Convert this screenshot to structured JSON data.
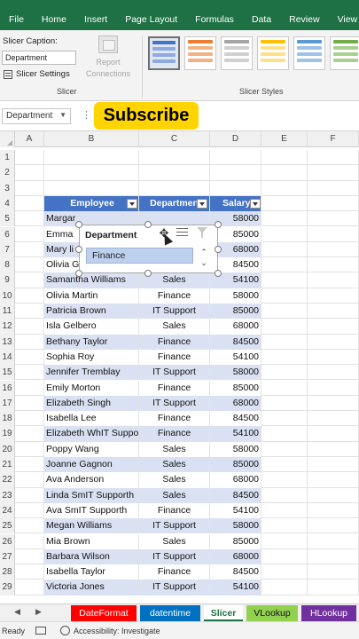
{
  "ribbon": {
    "tabs": [
      "File",
      "Home",
      "Insert",
      "Page Layout",
      "Formulas",
      "Data",
      "Review",
      "View"
    ],
    "slicer_caption_label": "Slicer Caption:",
    "slicer_caption_value": "Department",
    "slicer_settings_label": "Slicer Settings",
    "report_connections_label": "Report Connections",
    "slicer_group_label": "Slicer",
    "slicer_styles_group_label": "Slicer Styles",
    "style_colors": [
      "#4472c4",
      "#ed7d31",
      "#a5a5a5",
      "#ffc000",
      "#5b9bd5",
      "#70ad47"
    ]
  },
  "formula_bar": {
    "name_box": "Department",
    "overlay_text": "Subscribe"
  },
  "columns": [
    "A",
    "B",
    "C",
    "D",
    "E",
    "F"
  ],
  "table": {
    "headers": [
      "Employee",
      "Departmen",
      "Salary"
    ],
    "rows": [
      [
        "Margar",
        "",
        "58000"
      ],
      [
        "Emma",
        "",
        "85000"
      ],
      [
        "Mary li",
        "",
        "68000"
      ],
      [
        "Olivia G",
        "Sales",
        "84500"
      ],
      [
        "Samantha Williams",
        "Sales",
        "54100"
      ],
      [
        "Olivia Martin",
        "Finance",
        "58000"
      ],
      [
        "Patricia Brown",
        "IT Support",
        "85000"
      ],
      [
        "Isla Gelbero",
        "Sales",
        "68000"
      ],
      [
        "Bethany Taylor",
        "Finance",
        "84500"
      ],
      [
        "Sophia Roy",
        "Finance",
        "54100"
      ],
      [
        "Jennifer Tremblay",
        "IT Support",
        "58000"
      ],
      [
        "Emily Morton",
        "Finance",
        "85000"
      ],
      [
        "Elizabeth Singh",
        "IT Support",
        "68000"
      ],
      [
        "Isabella Lee",
        "Finance",
        "84500"
      ],
      [
        "Elizabeth WhIT Suppo",
        "Finance",
        "54100"
      ],
      [
        "Poppy Wang",
        "Sales",
        "58000"
      ],
      [
        "Joanne Gagnon",
        "Sales",
        "85000"
      ],
      [
        "Ava Anderson",
        "Sales",
        "68000"
      ],
      [
        "Linda SmIT Supporth",
        "Sales",
        "84500"
      ],
      [
        "Ava SmIT Supporth",
        "Finance",
        "54100"
      ],
      [
        "Megan Williams",
        "IT Support",
        "58000"
      ],
      [
        "Mia Brown",
        "Sales",
        "85000"
      ],
      [
        "Barbara Wilson",
        "IT Support",
        "68000"
      ],
      [
        "Isabella Taylor",
        "Finance",
        "84500"
      ],
      [
        "Victoria Jones",
        "IT Support",
        "54100"
      ]
    ]
  },
  "row_numbers": [
    "1",
    "2",
    "3",
    "4",
    "5",
    "6",
    "7",
    "8",
    "9",
    "10",
    "11",
    "12",
    "13",
    "14",
    "15",
    "16",
    "17",
    "18",
    "19",
    "20",
    "21",
    "22",
    "23",
    "24",
    "25",
    "26",
    "27",
    "28",
    "29"
  ],
  "slicer": {
    "title": "Department",
    "selected_item": "Finance"
  },
  "sheet_tabs": [
    {
      "label": "DateFormat",
      "color": "#ff0000",
      "text_color": "#ffffff"
    },
    {
      "label": "datentime",
      "color": "#0070c0",
      "text_color": "#ffffff"
    },
    {
      "label": "Slicer",
      "color": "#ffffff",
      "text_color": "#1e7145"
    },
    {
      "label": "VLookup",
      "color": "#92d050",
      "text_color": "#111111"
    },
    {
      "label": "HLookup",
      "color": "#7030a0",
      "text_color": "#ffffff"
    }
  ],
  "status": {
    "ready": "Ready",
    "accessibility": "Accessibility: Investigate"
  }
}
